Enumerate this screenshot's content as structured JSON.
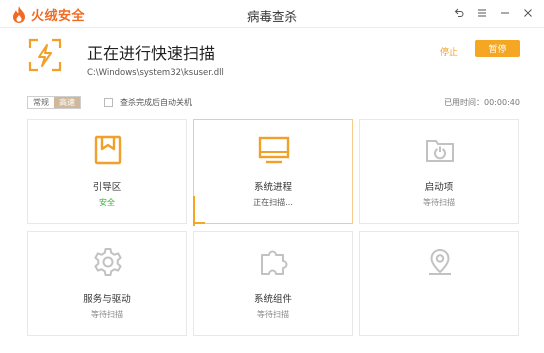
{
  "app": {
    "name": "火绒安全",
    "window_title": "病毒查杀"
  },
  "window_controls": {
    "icons": [
      "back-icon",
      "menu-icon",
      "minimize-icon",
      "close-icon"
    ]
  },
  "scan": {
    "title": "正在进行快速扫描",
    "current_file": "C:\\Windows\\system32\\ksuser.dll",
    "stop_label": "停止",
    "pause_label": "暂停"
  },
  "options": {
    "modes": [
      "常规",
      "高速"
    ],
    "active_mode": "高速",
    "auto_shutdown_label": "查杀完成后自动关机",
    "auto_shutdown_checked": false,
    "elapsed_label": "已用时间：00:00:40"
  },
  "items": [
    {
      "name": "引导区",
      "status": "安全",
      "icon": "bookmark-icon"
    },
    {
      "name": "系统进程",
      "status": "正在扫描...",
      "icon": "monitor-icon"
    },
    {
      "name": "启动项",
      "status": "等待扫描",
      "icon": "power-folder-icon"
    },
    {
      "name": "服务与驱动",
      "status": "等待扫描",
      "icon": "gear-icon"
    },
    {
      "name": "系统组件",
      "status": "等待扫描",
      "icon": "puzzle-icon"
    },
    {
      "name": "",
      "status": "",
      "icon": "location-pin-icon"
    }
  ],
  "colors": {
    "accent": "#f5a623",
    "brand": "#f26a21",
    "safe": "#35b235",
    "active_icon": "#f0a02b",
    "idle_icon": "#c2c2c2"
  }
}
